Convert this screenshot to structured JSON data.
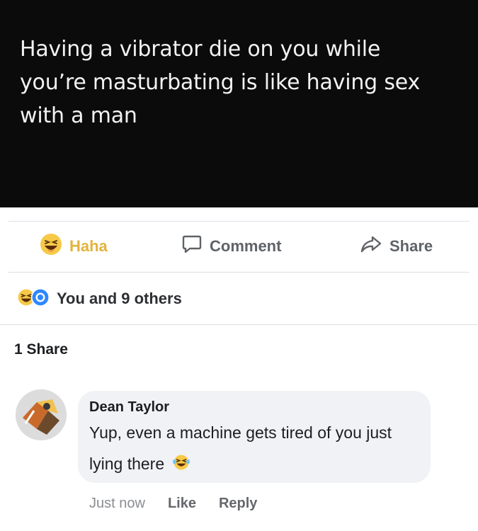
{
  "post": {
    "text": "Having a vibrator die on you while you’re masturbating is like having sex with a man"
  },
  "actions": {
    "haha_label": "Haha",
    "comment_label": "Comment",
    "share_label": "Share"
  },
  "reactions": {
    "summary": "You and 9 others",
    "icons": [
      "haha-emoji-icon",
      "care-emoji-icon"
    ]
  },
  "shares": {
    "count_text": "1 Share"
  },
  "comment": {
    "author": "Dean Taylor",
    "text": "Yup, even a machine gets tired of you just lying there",
    "emoji": "laughing-emoji-icon",
    "time": "Just now",
    "like_label": "Like",
    "reply_label": "Reply"
  },
  "colors": {
    "haha_accent": "#e2b33c",
    "image_background": "#0b0b0b",
    "bubble_background": "#f0f2f5",
    "muted_text": "#65676b"
  }
}
